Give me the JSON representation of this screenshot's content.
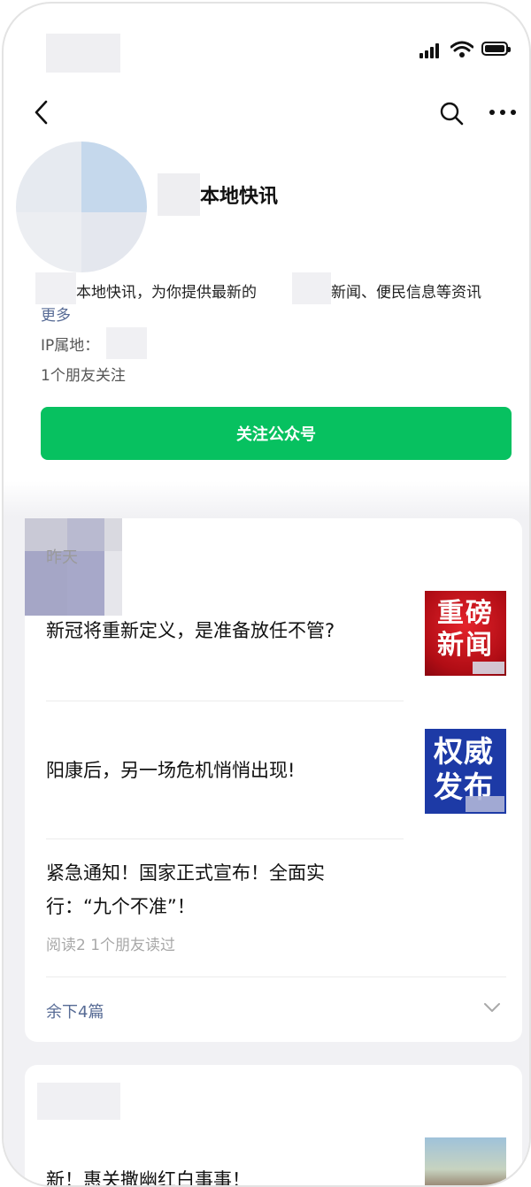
{
  "status_bar": {
    "signal_icon": "signal-icon",
    "wifi_icon": "wifi-icon",
    "battery_icon": "battery-icon"
  },
  "nav": {
    "back_icon": "back-icon",
    "search_icon": "search-icon",
    "more_icon": "more-icon"
  },
  "profile": {
    "name": "本地快讯",
    "description_part1": "本地快讯，为你提供最新的",
    "description_part2": "新闻、便民信息等资讯",
    "more_link": "更多",
    "ip_label": "IP属地：",
    "friends_following": "1个朋友关注",
    "follow_button": "关注公众号"
  },
  "feed": {
    "date": "昨天",
    "articles": [
      {
        "title": "新冠将重新定义，是准备放任不管?",
        "thumb_text": "重磅新闻"
      },
      {
        "title": "阳康后，另一场危机悄悄出现!",
        "thumb_text": "权威发布"
      },
      {
        "title": "紧急通知！国家正式宣布！全面实行：“九个不准”！",
        "meta": "阅读2  1个朋友读过"
      }
    ],
    "remaining": "余下4篇",
    "expand_icon": "chevron-down-icon",
    "next_card_title": "新！惠关撒幽红白事事！"
  },
  "colors": {
    "accent_green": "#07c160",
    "link_blue": "#576b95"
  }
}
